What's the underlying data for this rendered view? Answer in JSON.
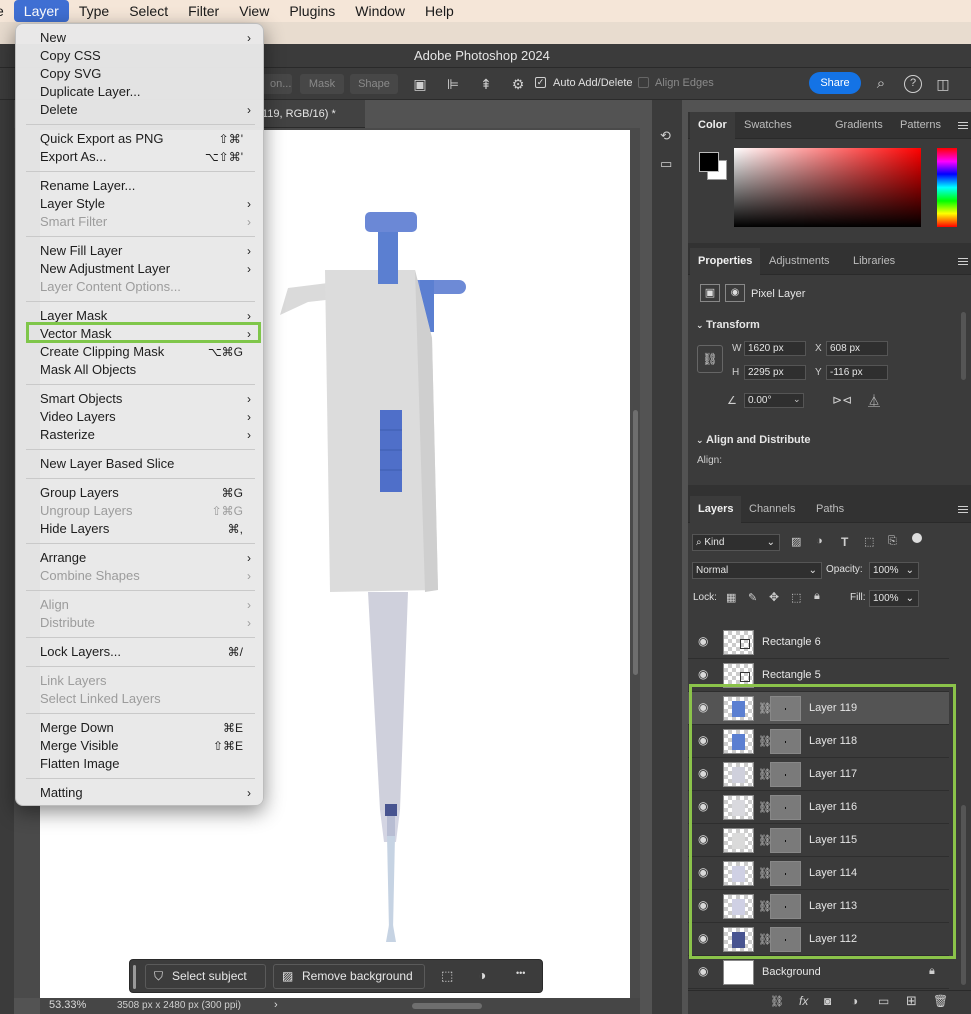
{
  "menubar": {
    "items": [
      "e",
      "Layer",
      "Type",
      "Select",
      "Filter",
      "View",
      "Plugins",
      "Window",
      "Help"
    ],
    "active": "Layer"
  },
  "window": {
    "title": "Adobe Photoshop 2024"
  },
  "options_bar": {
    "btn_partial": "on...",
    "mask_label": "Mask",
    "shape_label": "Shape",
    "auto_add_delete": "Auto Add/Delete",
    "align_edges": "Align Edges",
    "share_label": "Share"
  },
  "document_tab": {
    "label": "119, RGB/16) *"
  },
  "status_bar": {
    "zoom": "53.33%",
    "dims": "3508 px x 2480 px (300 ppi)",
    "arrow": "›"
  },
  "contextual_bar": {
    "select_subject": "Select subject",
    "remove_background": "Remove background",
    "more": "•••"
  },
  "color_panel": {
    "tabs": [
      "Color",
      "Swatches",
      "Gradients",
      "Patterns"
    ],
    "active": "Color",
    "fg": "#000000",
    "bg": "#ffffff"
  },
  "properties_panel": {
    "tabs": [
      "Properties",
      "Adjustments",
      "Libraries"
    ],
    "active": "Properties",
    "layer_type": "Pixel Layer",
    "transform_title": "Transform",
    "w": "1620 px",
    "h": "2295 px",
    "x": "608 px",
    "y": "-116 px",
    "w_lbl": "W",
    "h_lbl": "H",
    "x_lbl": "X",
    "y_lbl": "Y",
    "angle": "0.00°",
    "align_title": "Align and Distribute",
    "align_lbl": "Align:"
  },
  "layers_panel": {
    "tabs": [
      "Layers",
      "Channels",
      "Paths"
    ],
    "active": "Layers",
    "kind": "Kind",
    "blend_mode": "Normal",
    "opacity_lbl": "Opacity:",
    "opacity": "100%",
    "lock_lbl": "Lock:",
    "fill_lbl": "Fill:",
    "fill": "100%",
    "layers": [
      {
        "name": "Rectangle 6",
        "kind": "shape"
      },
      {
        "name": "Rectangle 5",
        "kind": "shape"
      },
      {
        "name": "Layer 119",
        "kind": "pixel",
        "swatch": "#5b7fd1",
        "selected": true
      },
      {
        "name": "Layer 118",
        "kind": "pixel",
        "swatch": "#5b7fd1"
      },
      {
        "name": "Layer 117",
        "kind": "pixel",
        "swatch": "#cfd0dc"
      },
      {
        "name": "Layer 116",
        "kind": "pixel",
        "swatch": "#d9d9de"
      },
      {
        "name": "Layer 115",
        "kind": "pixel",
        "swatch": "#dadada"
      },
      {
        "name": "Layer 114",
        "kind": "pixel",
        "swatch": "#cfd0e4"
      },
      {
        "name": "Layer 113",
        "kind": "pixel",
        "swatch": "#cfd0e4"
      },
      {
        "name": "Layer 112",
        "kind": "pixel",
        "swatch": "#485490"
      },
      {
        "name": "Background",
        "kind": "background"
      }
    ]
  },
  "layer_menu": {
    "items": [
      {
        "label": "New",
        "arrow": true
      },
      {
        "label": "Copy CSS"
      },
      {
        "label": "Copy SVG"
      },
      {
        "label": "Duplicate Layer..."
      },
      {
        "label": "Delete",
        "arrow": true
      },
      {
        "sep": true
      },
      {
        "label": "Quick Export as PNG",
        "sc": "⇧⌘'"
      },
      {
        "label": "Export As...",
        "sc": "⌥⇧⌘'"
      },
      {
        "sep": true
      },
      {
        "label": "Rename Layer..."
      },
      {
        "label": "Layer Style",
        "arrow": true
      },
      {
        "label": "Smart Filter",
        "arrow": true,
        "disabled": true
      },
      {
        "sep": true
      },
      {
        "label": "New Fill Layer",
        "arrow": true
      },
      {
        "label": "New Adjustment Layer",
        "arrow": true
      },
      {
        "label": "Layer Content Options...",
        "disabled": true
      },
      {
        "sep": true
      },
      {
        "label": "Layer Mask",
        "arrow": true
      },
      {
        "label": "Vector Mask",
        "arrow": true
      },
      {
        "label": "Create Clipping Mask",
        "sc": "⌥⌘G"
      },
      {
        "label": "Mask All Objects"
      },
      {
        "sep": true
      },
      {
        "label": "Smart Objects",
        "arrow": true
      },
      {
        "label": "Video Layers",
        "arrow": true
      },
      {
        "label": "Rasterize",
        "arrow": true
      },
      {
        "sep": true
      },
      {
        "label": "New Layer Based Slice"
      },
      {
        "sep": true
      },
      {
        "label": "Group Layers",
        "sc": "⌘G"
      },
      {
        "label": "Ungroup Layers",
        "sc": "⇧⌘G",
        "disabled": true
      },
      {
        "label": "Hide Layers",
        "sc": "⌘,"
      },
      {
        "sep": true
      },
      {
        "label": "Arrange",
        "arrow": true
      },
      {
        "label": "Combine Shapes",
        "arrow": true,
        "disabled": true
      },
      {
        "sep": true
      },
      {
        "label": "Align",
        "arrow": true,
        "disabled": true
      },
      {
        "label": "Distribute",
        "arrow": true,
        "disabled": true
      },
      {
        "sep": true
      },
      {
        "label": "Lock Layers...",
        "sc": "⌘/"
      },
      {
        "sep": true
      },
      {
        "label": "Link Layers",
        "disabled": true
      },
      {
        "label": "Select Linked Layers",
        "disabled": true
      },
      {
        "sep": true
      },
      {
        "label": "Merge Down",
        "sc": "⌘E"
      },
      {
        "label": "Merge Visible",
        "sc": "⇧⌘E"
      },
      {
        "label": "Flatten Image"
      },
      {
        "sep": true
      },
      {
        "label": "Matting",
        "arrow": true
      }
    ]
  }
}
